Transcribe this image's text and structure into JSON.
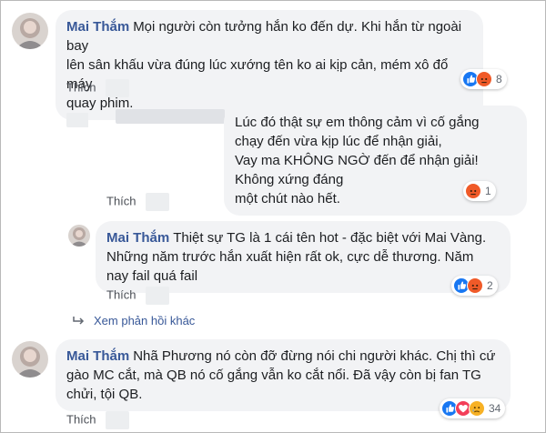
{
  "comments": [
    {
      "author": "Mai Thắm",
      "lines": "Mọi người còn tưởng hắn ko đến dự. Khi hắn từ ngoài bay\nlên sân khấu vừa đúng lúc xướng tên ko ai kịp cản, mém xô đổ máy\nquay phim.",
      "like_label": "Thích",
      "reaction_icons": [
        "like-icon",
        "angry-icon"
      ],
      "reaction_count": "8"
    },
    {
      "author": "",
      "lines": "Lúc đó thật sự em thông cảm vì cố gắng\nchạy đến vừa kịp lúc để nhận giải,\nVay ma KHÔNG NGỜ đến để nhận giải! Không xứng đáng\nmột chút nào hết.",
      "like_label": "Thích",
      "reaction_icons": [
        "angry-icon"
      ],
      "reaction_count": "1"
    },
    {
      "author": "Mai Thắm",
      "lines": "Thiệt sự TG là 1 cái tên hot - đặc biệt với Mai Vàng.\nNhững năm trước hắn xuất hiện rất ok, cực dễ thương. Năm\nnay fail quá fail",
      "like_label": "Thích",
      "reaction_icons": [
        "like-icon",
        "angry-icon"
      ],
      "reaction_count": "2"
    },
    {
      "author": "Mai Thắm",
      "lines": "Nhã Phương nó còn đỡ đừng nói chi người khác. Chị thì cứ\ngào MC cắt, mà QB nó cố gắng vẫn ko cắt nổi. Đã vậy còn bị fan TG\nchửi, tội QB.",
      "like_label": "Thích",
      "reaction_icons": [
        "like-icon",
        "love-icon",
        "sad-icon"
      ],
      "reaction_count": "34"
    }
  ],
  "more_replies_label": "Xem phản hồi khác",
  "colors": {
    "author": "#385898",
    "bubble": "#f2f3f5",
    "like": "#1877f2",
    "angry": "#f05a28",
    "love": "#f33e58"
  }
}
